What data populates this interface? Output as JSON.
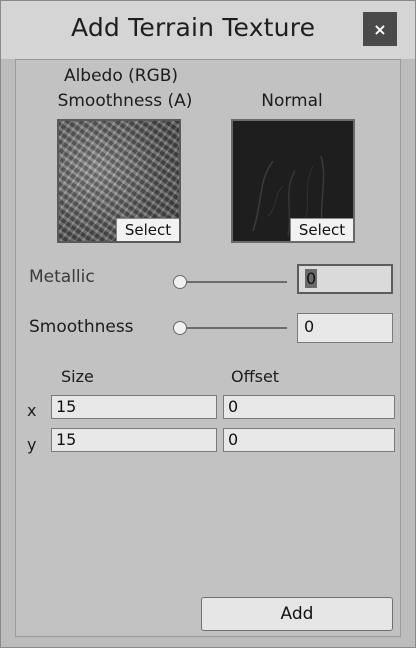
{
  "window": {
    "title": "Add Terrain Texture",
    "close_symbol": "×"
  },
  "albedo": {
    "label_line1": "Albedo (RGB)",
    "label_line2": "Smoothness (A)",
    "select_label": "Select"
  },
  "normal": {
    "label": "Normal",
    "select_label": "Select"
  },
  "metallic": {
    "label": "Metallic",
    "value": "0",
    "slider_fraction": 0
  },
  "smoothness": {
    "label": "Smoothness",
    "value": "0",
    "slider_fraction": 0
  },
  "tiling": {
    "size_header": "Size",
    "offset_header": "Offset",
    "x_label": "x",
    "y_label": "y",
    "size_x": "15",
    "size_y": "15",
    "offset_x": "0",
    "offset_y": "0"
  },
  "add_label": "Add",
  "colors": {
    "background": "#bcbcbc",
    "titlebar": "#d5d5d5",
    "close_button": "#4a4a4a"
  }
}
